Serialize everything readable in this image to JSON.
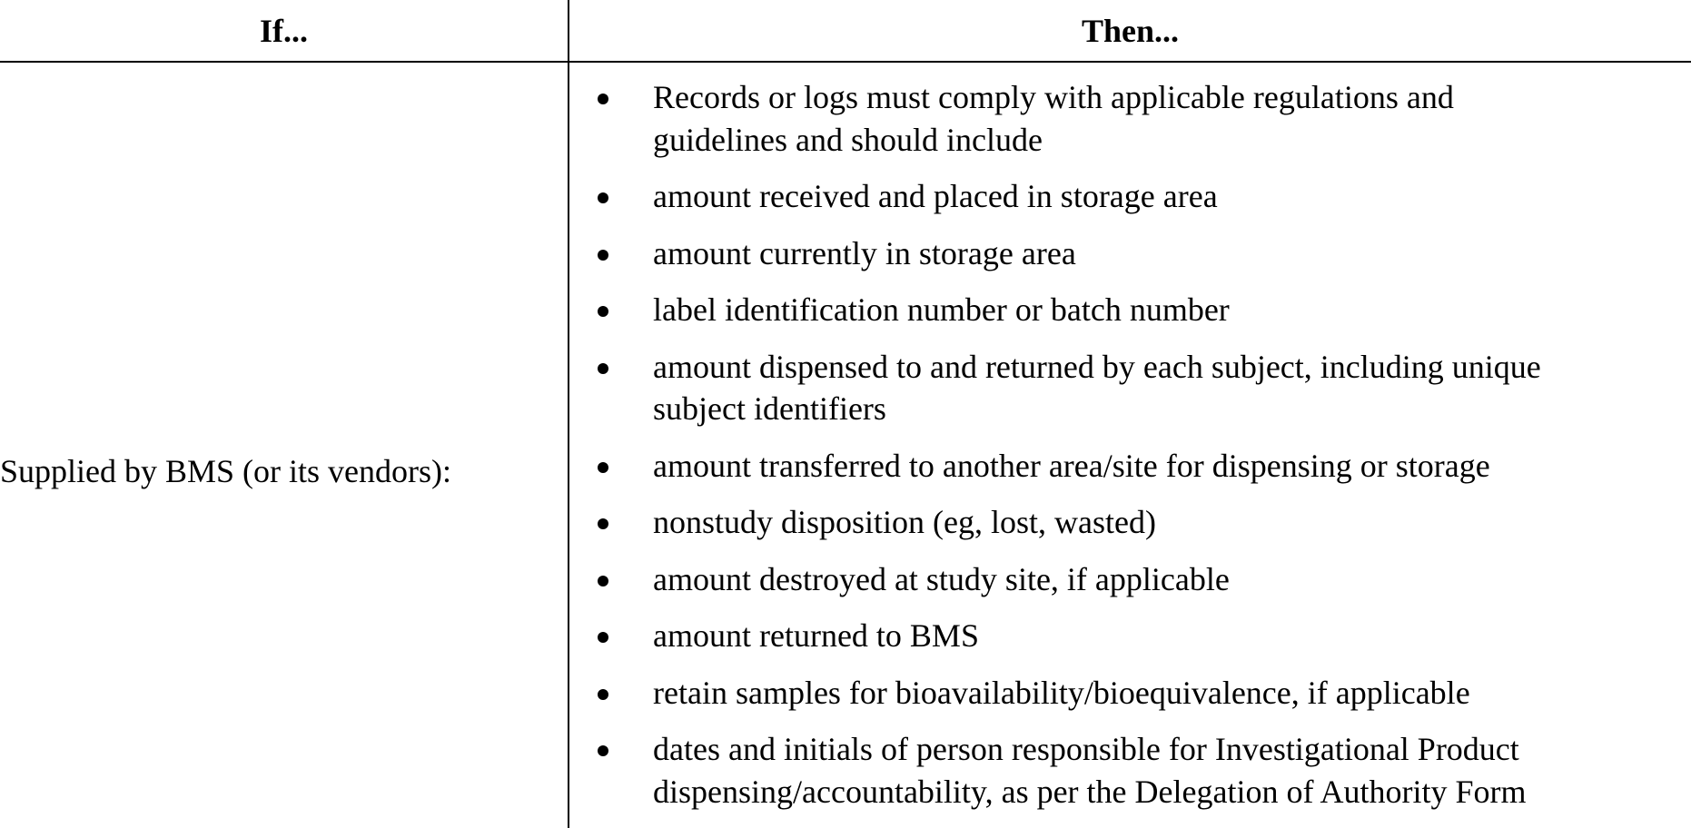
{
  "table": {
    "header_if": "If...",
    "header_then": "Then...",
    "if_cell": "Supplied by BMS (or its vendors):",
    "then_items": [
      [
        "Records or logs must comply with applicable regulations and",
        "guidelines and should include"
      ],
      [
        "amount received and placed in storage area"
      ],
      [
        "amount currently in storage area"
      ],
      [
        "label identification number or batch number"
      ],
      [
        "amount dispensed to and returned by each subject, including unique",
        "subject identifiers"
      ],
      [
        "amount transferred to another area/site for dispensing or storage"
      ],
      [
        "nonstudy disposition (eg, lost, wasted)"
      ],
      [
        "amount destroyed at study site, if applicable"
      ],
      [
        "amount returned to BMS"
      ],
      [
        "retain samples for bioavailability/bioequivalence, if applicable"
      ],
      [
        "dates and initials of person responsible for Investigational Product",
        "dispensing/accountability, as per the Delegation of Authority Form"
      ]
    ]
  }
}
